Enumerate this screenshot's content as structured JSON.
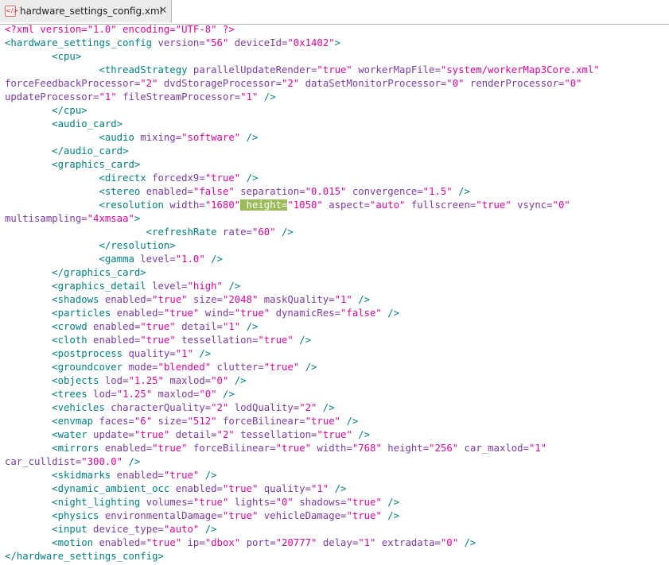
{
  "tab": {
    "icon": "xml-file-icon",
    "icon_glyph": "</>",
    "filename": "hardware_settings_config.xml",
    "close_glyph": "✕"
  },
  "highlight": {
    "line": 13,
    "token": 3
  },
  "lines": [
    [
      "<?xml version=\"1.0\" encoding=\"UTF-8\" ?>"
    ],
    [
      "<hardware_settings_config",
      " version=",
      "\"56\"",
      " deviceId=",
      "\"0x1402\"",
      ">"
    ],
    [
      "        <cpu>"
    ],
    [
      "                <threadStrategy",
      " parallelUpdateRender=",
      "\"true\"",
      " workerMapFile=",
      "\"system/workerMap3Core.xml\""
    ],
    [
      "forceFeedbackProcessor=",
      "\"2\"",
      " dvdStorageProcessor=",
      "\"2\"",
      " dataSetMonitorProcessor=",
      "\"0\"",
      " renderProcessor=",
      "\"0\""
    ],
    [
      "updateProcessor=",
      "\"1\"",
      " fileStreamProcessor=",
      "\"1\"",
      " />"
    ],
    [
      "        </cpu>"
    ],
    [
      "        <audio_card>"
    ],
    [
      "                <audio",
      " mixing=",
      "\"software\"",
      " />"
    ],
    [
      "        </audio_card>"
    ],
    [
      "        <graphics_card>"
    ],
    [
      "                <directx",
      " forcedx9=",
      "\"",
      "true",
      "\"",
      " />"
    ],
    [
      "                <stereo",
      " enabled=",
      "\"false\"",
      " separation=",
      "\"0.015\"",
      " convergence=",
      "\"1.5\"",
      " />"
    ],
    [
      "                <resolution",
      " width=",
      "\"1680\"",
      " height=",
      "\"1050\"",
      " aspect=",
      "\"auto\"",
      " fullscreen=",
      "\"true\"",
      " vsync=",
      "\"0\""
    ],
    [
      "multisampling=",
      "\"4xmsaa\"",
      ">"
    ],
    [
      "                        <refreshRate",
      " rate=",
      "\"60\"",
      " />"
    ],
    [
      "                </resolution>"
    ],
    [
      "                <gamma",
      " level=",
      "\"1.0\"",
      " />"
    ],
    [
      "        </graphics_card>"
    ],
    [
      "        <graphics_detail",
      " level=",
      "\"high\"",
      " />"
    ],
    [
      "        <shadows",
      " enabled=",
      "\"true\"",
      " size=",
      "\"2048\"",
      " maskQuality=",
      "\"1\"",
      " />"
    ],
    [
      "        <particles",
      " enabled=",
      "\"true\"",
      " wind=",
      "\"true\"",
      " dynamicRes=",
      "\"false\"",
      " />"
    ],
    [
      "        <crowd",
      " enabled=",
      "\"true\"",
      " detail=",
      "\"1\"",
      " />"
    ],
    [
      "        <cloth",
      " enabled=",
      "\"true\"",
      " tessellation=",
      "\"true\"",
      " />"
    ],
    [
      "        <postprocess",
      " quality=",
      "\"1\"",
      " />"
    ],
    [
      "        <groundcover",
      " mode=",
      "\"blended\"",
      " clutter=",
      "\"true\"",
      " />"
    ],
    [
      "        <objects",
      " lod=",
      "\"1.25\"",
      " maxlod=",
      "\"0\"",
      " />"
    ],
    [
      "        <trees",
      " lod=",
      "\"1.25\"",
      " maxlod=",
      "\"0\"",
      " />"
    ],
    [
      "        <vehicles",
      " characterQuality=",
      "\"2\"",
      " lodQuality=",
      "\"2\"",
      " />"
    ],
    [
      "        <envmap",
      " faces=",
      "\"6\"",
      " size=",
      "\"512\"",
      " forceBilinear=",
      "\"true\"",
      " />"
    ],
    [
      "        <water",
      " update=",
      "\"true\"",
      " detail=",
      "\"2\"",
      " tessellation=",
      "\"true\"",
      " />"
    ],
    [
      "        <mirrors",
      " enabled=",
      "\"true\"",
      " forceBilinear=",
      "\"true\"",
      " width=",
      "\"768\"",
      " height=",
      "\"256\"",
      " car_maxlod=",
      "\"1\""
    ],
    [
      "car_culldist=",
      "\"300.0\"",
      " />"
    ],
    [
      "        <skidmarks",
      " enabled=",
      "\"true\"",
      " />"
    ],
    [
      "        <dynamic_ambient_occ",
      " enabled=",
      "\"true\"",
      " quality=",
      "\"1\"",
      " />"
    ],
    [
      "        <night_lighting",
      " volumes=",
      "\"true\"",
      " lights=",
      "\"0\"",
      " shadows=",
      "\"true\"",
      " />"
    ],
    [
      "        <physics",
      " environmentalDamage=",
      "\"true\"",
      " vehicleDamage=",
      "\"true\"",
      " />"
    ],
    [
      "        <input",
      " device_type=",
      "\"auto\"",
      " />"
    ],
    [
      "        <motion",
      " enabled=",
      "\"true\"",
      " ip=",
      "\"dbox\"",
      " port=",
      "\"20777\"",
      " delay=",
      "\"1\"",
      " extradata=",
      "\"0\"",
      " />"
    ],
    [
      "</hardware_settings_config>"
    ]
  ]
}
